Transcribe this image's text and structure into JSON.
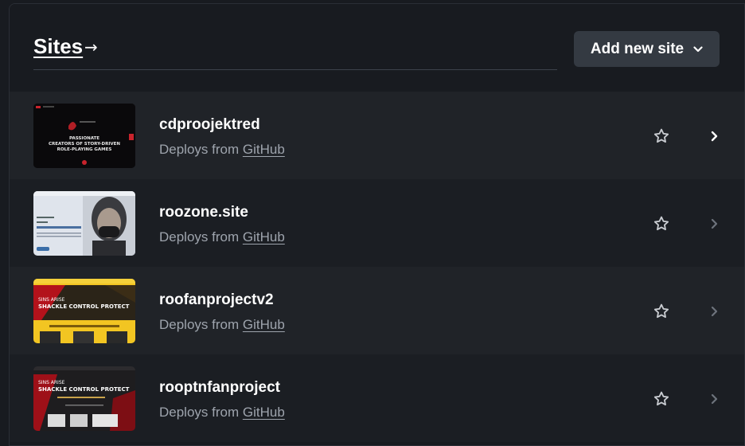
{
  "header": {
    "title": "Sites",
    "title_arrow": "→",
    "add_button_label": "Add new site"
  },
  "sites": [
    {
      "name": "cdproojektred",
      "deploy_prefix": "Deploys from",
      "provider": "GitHub",
      "thumb_text": [
        "PASSIONATE",
        "CREATORS OF STORY-DRIVEN",
        "ROLE-PLAYING GAMES"
      ]
    },
    {
      "name": "roozone.site",
      "deploy_prefix": "Deploys from",
      "provider": "GitHub"
    },
    {
      "name": "roofanprojectv2",
      "deploy_prefix": "Deploys from",
      "provider": "GitHub",
      "thumb_text": [
        "SINS ARISE",
        "SHACKLE CONTROL PROTECT"
      ]
    },
    {
      "name": "rooptnfanproject",
      "deploy_prefix": "Deploys from",
      "provider": "GitHub",
      "thumb_text": [
        "SINS ARISE",
        "SHACKLE CONTROL PROTECT"
      ]
    }
  ],
  "colors": {
    "page_bg": "#181b20",
    "row_a": "#202328",
    "row_b": "#1b1e23",
    "button_bg": "#343a42",
    "muted_text": "#9ea4ad"
  },
  "icons": [
    "arrow-right-icon",
    "chevron-down-icon",
    "star-icon",
    "chevron-right-icon"
  ]
}
